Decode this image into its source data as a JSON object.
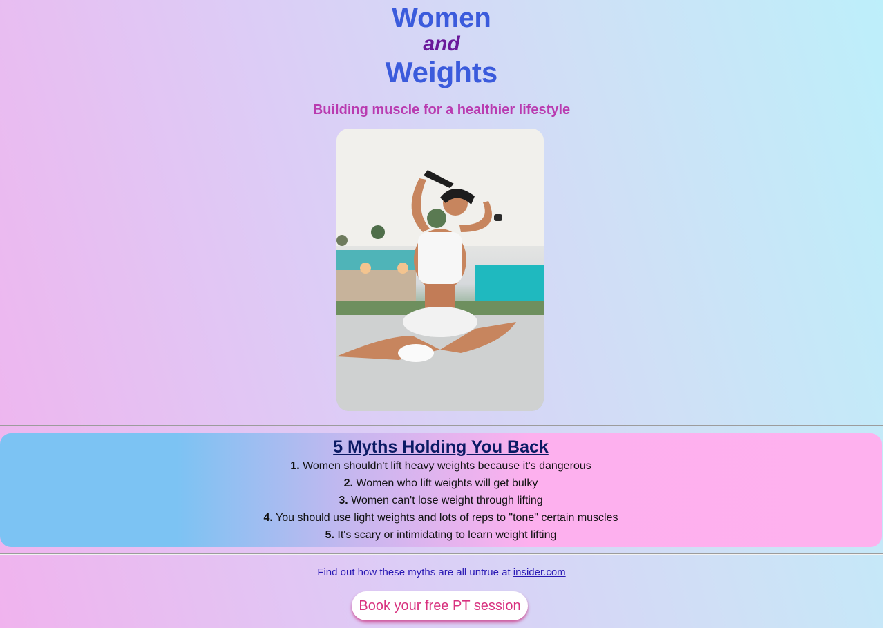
{
  "header": {
    "title_line1": "Women",
    "title_line2": "and",
    "title_line3": "Weights",
    "subtitle": "Building muscle for a healthier lifestyle"
  },
  "hero_image": {
    "alt": "Woman in white sportswear sitting on a track tying her hair"
  },
  "myths": {
    "heading": "5 Myths Holding You Back",
    "items": [
      {
        "num": "1.",
        "text": " Women shouldn't lift heavy weights because it's dangerous"
      },
      {
        "num": "2.",
        "text": " Women who lift weights will get bulky"
      },
      {
        "num": "3.",
        "text": " Women can't lose weight through lifting"
      },
      {
        "num": "4.",
        "text": " You should use light weights and lots of reps to \"tone\" certain muscles"
      },
      {
        "num": "5.",
        "text": " It's scary or intimidating to learn weight lifting"
      }
    ]
  },
  "footer": {
    "prefix": "Find out how these myths are all untrue at ",
    "link_text": "insider.com"
  },
  "cta": {
    "label": "Book your free PT session"
  },
  "colors": {
    "title_blue": "#3b5bdc",
    "and_purple": "#6a189a",
    "subtitle_magenta": "#b93bb0",
    "myths_heading": "#0b1a64",
    "cta_text": "#d8327f"
  }
}
